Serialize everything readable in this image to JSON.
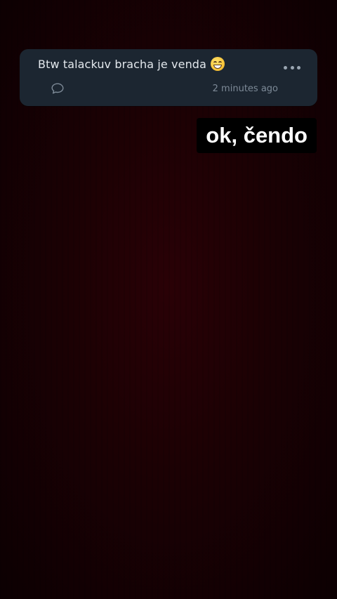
{
  "post": {
    "text": "Btw talackuv bracha je venda",
    "emoji": "grinning-face-with-smiling-eyes",
    "time": "2 minutes ago",
    "more_icon": "more-horizontal-icon",
    "comment_icon": "comment-bubble-icon"
  },
  "sticker": {
    "text": "ok, čendo"
  },
  "colors": {
    "background": "#1b0104",
    "card": "#1c2631",
    "card_text": "#e3e8ed",
    "muted": "#7d8a97",
    "sticker_bg": "#000000",
    "sticker_text": "#ffffff"
  }
}
